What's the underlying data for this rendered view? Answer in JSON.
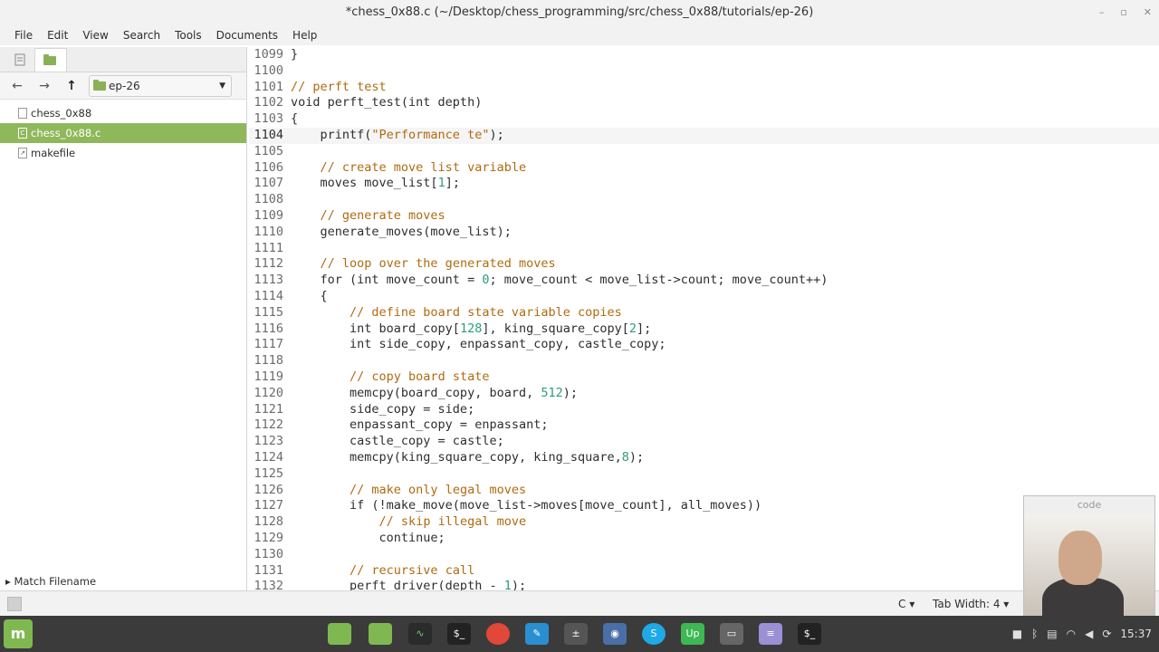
{
  "window": {
    "title": "*chess_0x88.c (~/Desktop/chess_programming/src/chess_0x88/tutorials/ep-26)",
    "controls": [
      "–",
      "▫",
      "✕"
    ]
  },
  "menu": [
    "File",
    "Edit",
    "View",
    "Search",
    "Tools",
    "Documents",
    "Help"
  ],
  "sidebar": {
    "path": "ep-26",
    "files": [
      {
        "name": "chess_0x88",
        "icon": "binary-file-icon",
        "selected": false
      },
      {
        "name": "chess_0x88.c",
        "icon": "c-file-icon",
        "selected": true
      },
      {
        "name": "makefile",
        "icon": "makefile-icon",
        "selected": false
      }
    ],
    "match_label": "Match Filename"
  },
  "editor": {
    "current_line": 1104,
    "lines": [
      {
        "n": "1099",
        "t": "}"
      },
      {
        "n": "1100",
        "t": ""
      },
      {
        "n": "1101",
        "t": "// perft test"
      },
      {
        "n": "1102",
        "t": "void perft_test(int depth)"
      },
      {
        "n": "1103",
        "t": "{"
      },
      {
        "n": "1104",
        "t": "    printf(\"Performance te\");"
      },
      {
        "n": "1105",
        "t": ""
      },
      {
        "n": "1106",
        "t": "    // create move list variable"
      },
      {
        "n": "1107",
        "t": "    moves move_list[1];"
      },
      {
        "n": "1108",
        "t": ""
      },
      {
        "n": "1109",
        "t": "    // generate moves"
      },
      {
        "n": "1110",
        "t": "    generate_moves(move_list);"
      },
      {
        "n": "1111",
        "t": ""
      },
      {
        "n": "1112",
        "t": "    // loop over the generated moves"
      },
      {
        "n": "1113",
        "t": "    for (int move_count = 0; move_count < move_list->count; move_count++)"
      },
      {
        "n": "1114",
        "t": "    {"
      },
      {
        "n": "1115",
        "t": "        // define board state variable copies"
      },
      {
        "n": "1116",
        "t": "        int board_copy[128], king_square_copy[2];"
      },
      {
        "n": "1117",
        "t": "        int side_copy, enpassant_copy, castle_copy;"
      },
      {
        "n": "1118",
        "t": ""
      },
      {
        "n": "1119",
        "t": "        // copy board state"
      },
      {
        "n": "1120",
        "t": "        memcpy(board_copy, board, 512);"
      },
      {
        "n": "1121",
        "t": "        side_copy = side;"
      },
      {
        "n": "1122",
        "t": "        enpassant_copy = enpassant;"
      },
      {
        "n": "1123",
        "t": "        castle_copy = castle;"
      },
      {
        "n": "1124",
        "t": "        memcpy(king_square_copy, king_square,8);"
      },
      {
        "n": "1125",
        "t": ""
      },
      {
        "n": "1126",
        "t": "        // make only legal moves"
      },
      {
        "n": "1127",
        "t": "        if (!make_move(move_list->moves[move_count], all_moves))"
      },
      {
        "n": "1128",
        "t": "            // skip illegal move"
      },
      {
        "n": "1129",
        "t": "            continue;"
      },
      {
        "n": "1130",
        "t": ""
      },
      {
        "n": "1131",
        "t": "        // recursive call"
      },
      {
        "n": "1132",
        "t": "        perft_driver(depth - 1);"
      }
    ]
  },
  "statusbar": {
    "language": "C",
    "tab_width": "Tab Width: 4"
  },
  "webcam": {
    "title": "code"
  },
  "taskbar": {
    "apps": [
      "files-icon",
      "files-icon",
      "system-monitor-icon",
      "terminal-icon",
      "chrome-icon",
      "editor-icon",
      "calculator-icon",
      "camera-icon",
      "skype-icon",
      "upwork-icon",
      "window-icon",
      "text-editor-icon",
      "terminal-icon"
    ],
    "clock": "15:37"
  },
  "colors": {
    "comment": "#b06a10",
    "number": "#2a9d7a",
    "keyword": "#1d3b9a",
    "selection": "#8fb85b"
  }
}
